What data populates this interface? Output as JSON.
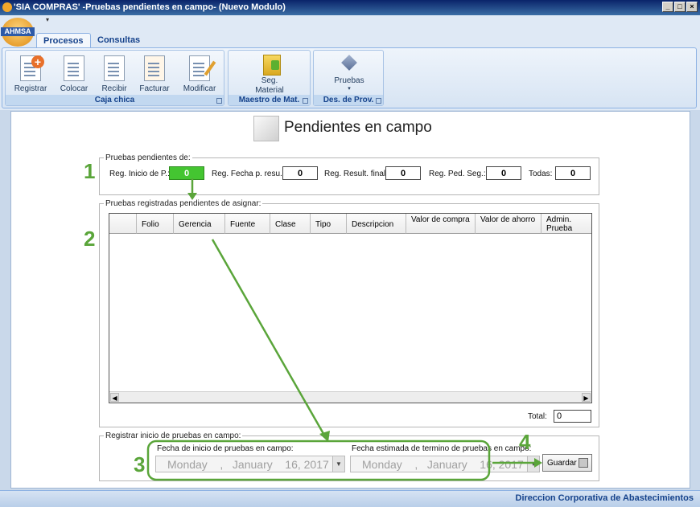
{
  "window": {
    "title": "'SIA COMPRAS' -Pruebas pendientes en campo- (Nuevo Modulo)"
  },
  "logo": {
    "text": "AHMSA"
  },
  "tabs": [
    "Procesos",
    "Consultas"
  ],
  "ribbon": {
    "groups": [
      {
        "label": "Caja chica",
        "buttons": [
          "Registrar",
          "Colocar",
          "Recibir",
          "Facturar",
          "Modificar"
        ]
      },
      {
        "label": "Maestro de Mat.",
        "buttons": [
          "Seg.\nMaterial"
        ]
      },
      {
        "label": "Des. de Prov.",
        "buttons": [
          "Pruebas"
        ]
      }
    ]
  },
  "page": {
    "title": "Pendientes en campo"
  },
  "pending": {
    "legend": "Pruebas pendientes de:",
    "fields": [
      {
        "label": "Reg. Inicio de P.:",
        "value": "0"
      },
      {
        "label": "Reg. Fecha p. resu.:",
        "value": "0"
      },
      {
        "label": "Reg. Result. final:",
        "value": "0"
      },
      {
        "label": "Reg. Ped. Seg.:",
        "value": "0"
      },
      {
        "label": "Todas:",
        "value": "0"
      }
    ]
  },
  "registered": {
    "legend": "Pruebas registradas pendientes de asignar:",
    "columns": [
      "",
      "Folio",
      "Gerencia",
      "Fuente",
      "Clase",
      "Tipo",
      "Descripcion",
      "Valor de compra",
      "Valor de ahorro",
      "Admin. Prueba"
    ],
    "total_label": "Total:",
    "total_value": "0"
  },
  "register_start": {
    "legend": "Registrar inicio de pruebas en campo:",
    "start_label": "Fecha de inicio de pruebas en campo:",
    "start_date": "Monday    ,   January    16, 2017",
    "end_label": "Fecha estimada de termino de pruebas en campo:",
    "end_date": "Monday    ,   January    16, 2017",
    "save_label": "Guardar"
  },
  "annotations": [
    "1",
    "2",
    "3",
    "4"
  ],
  "status": {
    "text": "Direccion Corporativa de Abastecimientos"
  },
  "colors": {
    "annotation": "#5aa53a",
    "highlight": "#44c531",
    "ribbon_text": "#15428b"
  }
}
